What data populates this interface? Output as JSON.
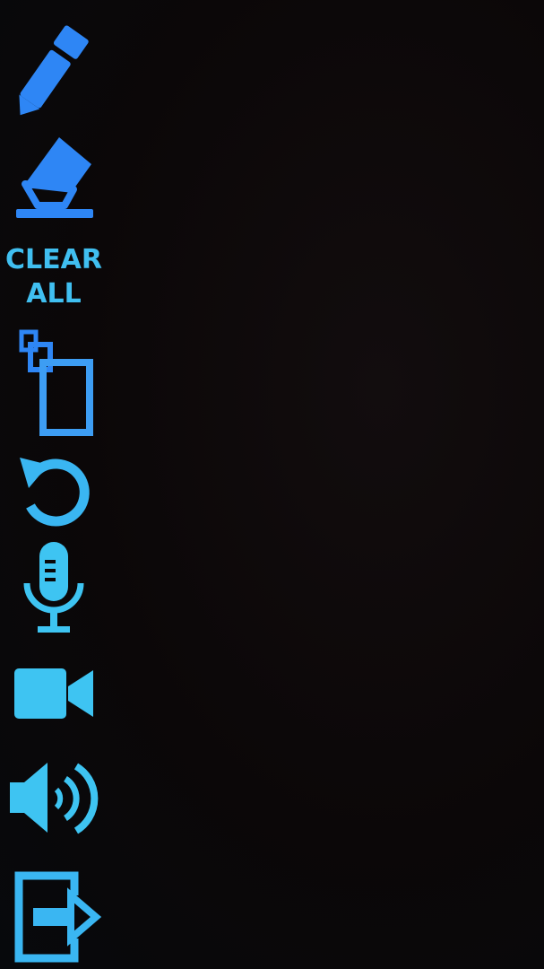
{
  "toolbar": {
    "tools": [
      {
        "name": "pen",
        "icon": "pen-icon"
      },
      {
        "name": "eraser",
        "icon": "eraser-icon"
      },
      {
        "name": "clear_all",
        "label_line1": "CLEAR",
        "label_line2": "ALL"
      },
      {
        "name": "duplicate",
        "icon": "duplicate-pages-icon"
      },
      {
        "name": "undo",
        "icon": "undo-icon"
      },
      {
        "name": "microphone",
        "icon": "microphone-icon"
      },
      {
        "name": "camera",
        "icon": "video-camera-icon"
      },
      {
        "name": "speaker",
        "icon": "speaker-icon"
      },
      {
        "name": "exit",
        "icon": "exit-icon"
      }
    ]
  },
  "colors": {
    "background": "#0a0708",
    "icon_blue": "#2e86f5",
    "icon_cyan": "#3dc4f2"
  }
}
